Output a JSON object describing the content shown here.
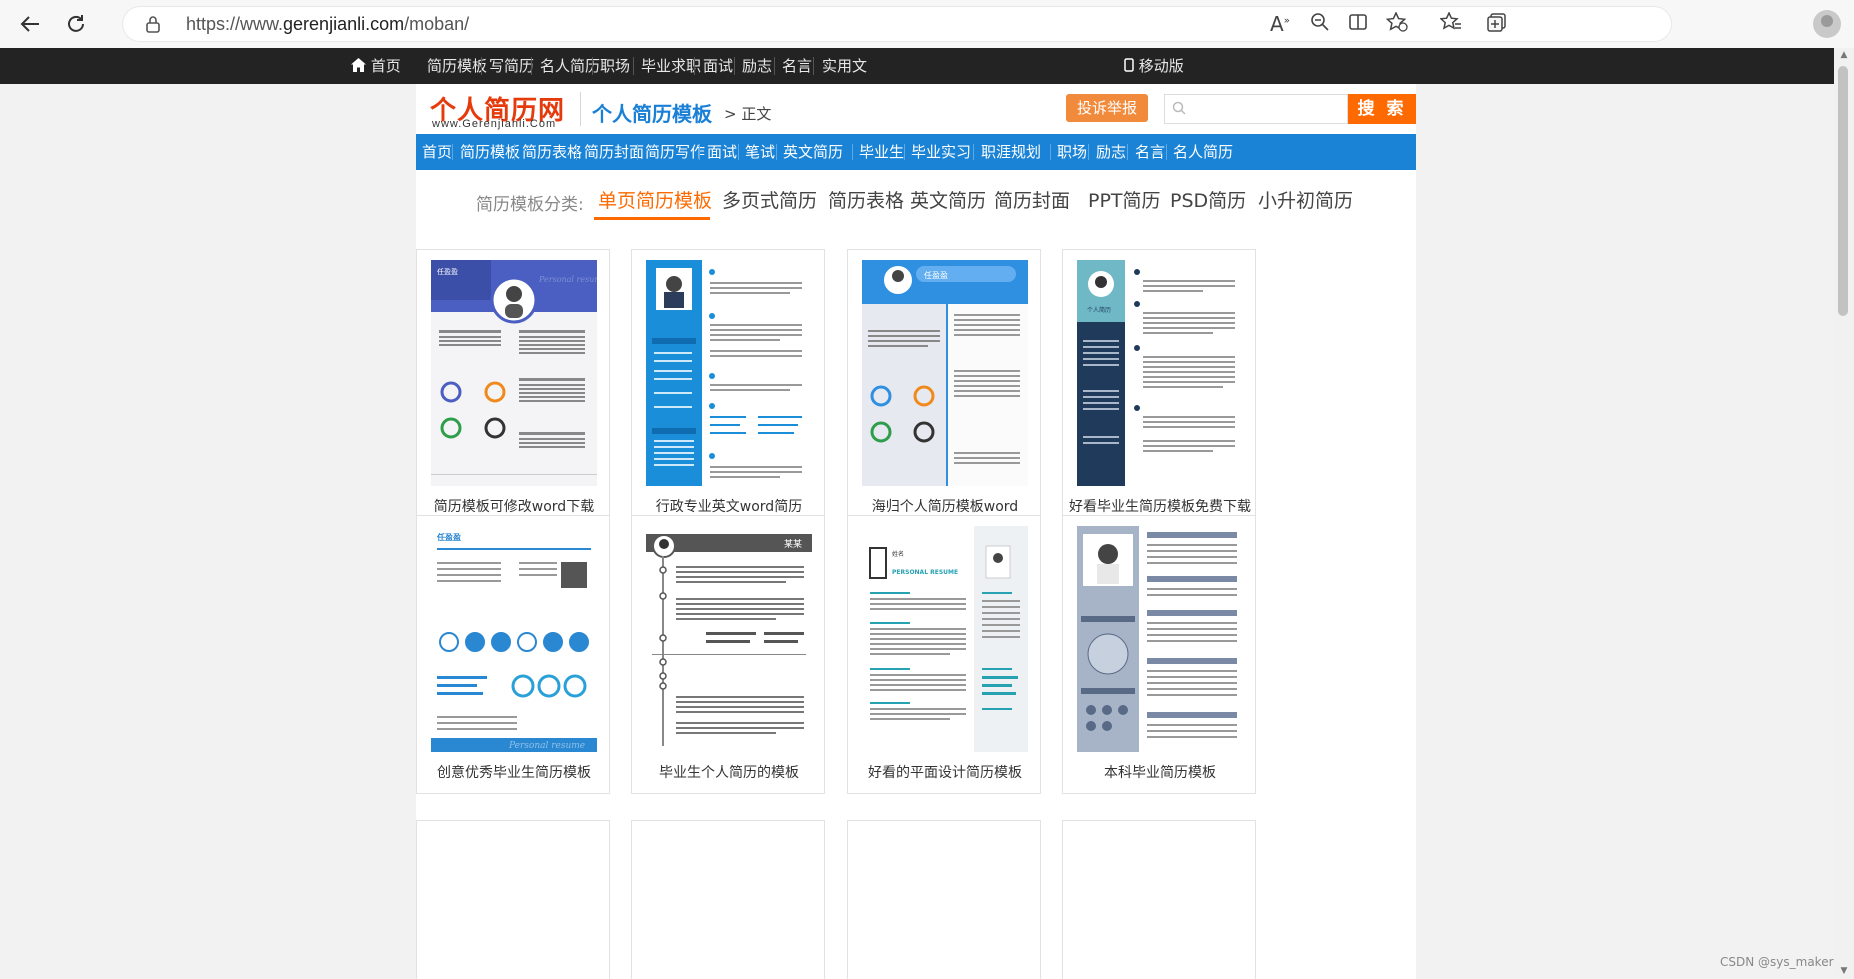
{
  "browser": {
    "url_prefix": "https://www.",
    "url_domain": "gerenjianli.com",
    "url_path": "/moban/"
  },
  "topbar": {
    "home": "首页",
    "items": [
      "简历模板",
      "写简历",
      "名人简历",
      "职场",
      "毕业求职",
      "面试",
      "励志",
      "名言",
      "实用文"
    ],
    "mobile": "移动版"
  },
  "header": {
    "logo_cn": "个人简历网",
    "logo_en": "www.Gerenjianli.Com",
    "section": "个人简历模板",
    "crumb": "> 正文",
    "report": "投诉举报",
    "search_placeholder": "",
    "search_button": "搜 索"
  },
  "nav": [
    "首页",
    "简历模板",
    "简历表格",
    "简历封面",
    "简历写作",
    "面试",
    "笔试",
    "英文简历",
    "毕业生",
    "毕业实习",
    "职涯规划",
    "职场",
    "励志",
    "名言",
    "名人简历"
  ],
  "categories": {
    "label": "简历模板分类:",
    "items": [
      "单页简历模板",
      "多页式简历",
      "简历表格",
      "英文简历",
      "简历封面",
      "PPT简历",
      "PSD简历",
      "小升初简历"
    ],
    "active_index": 0
  },
  "cards": [
    {
      "title": "简历模板可修改word下载",
      "name": "任盈盈",
      "banner": "Personal resume",
      "accent": "#4a5fc1"
    },
    {
      "title": "行政专业英文word简历",
      "name": "",
      "banner": "",
      "accent": "#1a8ed8"
    },
    {
      "title": "海归个人简历模板word",
      "name": "任盈盈",
      "banner": "",
      "accent": "#2f8fe0"
    },
    {
      "title": "好看毕业生简历模板免费下载",
      "name": "个人简历",
      "banner": "",
      "accent": "#1f3a5a"
    },
    {
      "title": "创意优秀毕业生简历模板",
      "name": "任盈盈",
      "banner": "Personal resume",
      "accent": "#2a87d2"
    },
    {
      "title": "毕业生个人简历的模板",
      "name": "某某",
      "banner": "",
      "accent": "#555555"
    },
    {
      "title": "好看的平面设计简历模板",
      "name": "PERSONAL RESUME",
      "banner": "",
      "accent": "#27a2b3"
    },
    {
      "title": "本科毕业简历模板",
      "name": "",
      "banner": "",
      "accent": "#7a8aa6"
    }
  ],
  "watermark": "CSDN @sys_maker",
  "colors": {
    "nav_blue": "#1a83d6",
    "orange": "#ff6a00",
    "topbar": "#232323"
  }
}
